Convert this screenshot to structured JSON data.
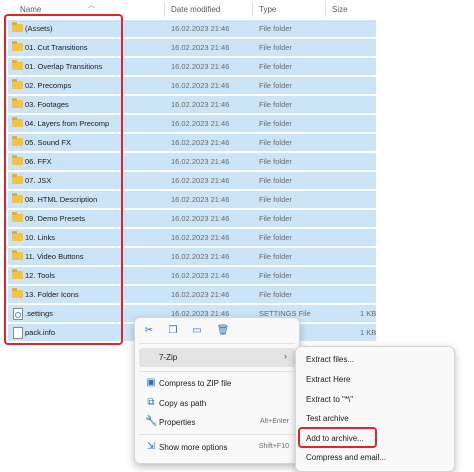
{
  "header": {
    "name": "Name",
    "date": "Date modified",
    "type": "Type",
    "size": "Size"
  },
  "files": [
    {
      "name": "(Assets)",
      "date": "16.02.2023 21:46",
      "type": "File folder",
      "size": "",
      "icon": "folder-icon"
    },
    {
      "name": "01. Cut Transitions",
      "date": "16.02.2023 21:46",
      "type": "File folder",
      "size": "",
      "icon": "folder-icon"
    },
    {
      "name": "01. Overlap Transitions",
      "date": "16.02.2023 21:46",
      "type": "File folder",
      "size": "",
      "icon": "folder-icon"
    },
    {
      "name": "02. Precomps",
      "date": "16.02.2023 21:46",
      "type": "File folder",
      "size": "",
      "icon": "folder-icon"
    },
    {
      "name": "03. Footages",
      "date": "16.02.2023 21:46",
      "type": "File folder",
      "size": "",
      "icon": "folder-icon"
    },
    {
      "name": "04. Layers from Precomp",
      "date": "16.02.2023 21:46",
      "type": "File folder",
      "size": "",
      "icon": "folder-icon"
    },
    {
      "name": "05. Sound FX",
      "date": "16.02.2023 21:46",
      "type": "File folder",
      "size": "",
      "icon": "folder-icon"
    },
    {
      "name": "06. FFX",
      "date": "16.02.2023 21:46",
      "type": "File folder",
      "size": "",
      "icon": "folder-icon"
    },
    {
      "name": "07. JSX",
      "date": "16.02.2023 21:46",
      "type": "File folder",
      "size": "",
      "icon": "folder-icon"
    },
    {
      "name": "08. HTML Description",
      "date": "16.02.2023 21:46",
      "type": "File folder",
      "size": "",
      "icon": "folder-icon"
    },
    {
      "name": "09. Demo Presets",
      "date": "16.02.2023 21:46",
      "type": "File folder",
      "size": "",
      "icon": "folder-icon"
    },
    {
      "name": "10. Links",
      "date": "16.02.2023 21:46",
      "type": "File folder",
      "size": "",
      "icon": "folder-icon"
    },
    {
      "name": "11. Video Buttons",
      "date": "16.02.2023 21:46",
      "type": "File folder",
      "size": "",
      "icon": "folder-icon"
    },
    {
      "name": "12. Tools",
      "date": "16.02.2023 21:46",
      "type": "File folder",
      "size": "",
      "icon": "folder-icon"
    },
    {
      "name": "13. Folder Icons",
      "date": "16.02.2023 21:46",
      "type": "File folder",
      "size": "",
      "icon": "folder-icon"
    },
    {
      "name": ".settings",
      "date": "16.02.2023 21:46",
      "type": "SETTINGS File",
      "size": "1 KB",
      "icon": "settings-file-icon"
    },
    {
      "name": "pack.info",
      "date": "",
      "type": "",
      "size": "1 KB",
      "icon": "file-icon"
    }
  ],
  "context_menu": {
    "toolbar": [
      "cut-icon",
      "copy-icon",
      "rename-icon",
      "delete-icon"
    ],
    "items": [
      {
        "label": "7-Zip",
        "shortcut": "",
        "icon": "",
        "has_submenu": true
      },
      {
        "label": "Compress to ZIP file",
        "shortcut": "",
        "icon": "zip-icon"
      },
      {
        "label": "Copy as path",
        "shortcut": "",
        "icon": "copy-path-icon"
      },
      {
        "label": "Properties",
        "shortcut": "Alt+Enter",
        "icon": "properties-icon"
      },
      {
        "label": "Show more options",
        "shortcut": "Shift+F10",
        "icon": "more-options-icon"
      }
    ]
  },
  "submenu": {
    "items": [
      {
        "label": "Extract files..."
      },
      {
        "label": "Extract Here"
      },
      {
        "label": "Extract to \"*\\\""
      },
      {
        "label": "Test archive"
      },
      {
        "label": "Add to archive..."
      },
      {
        "label": "Compress and email..."
      }
    ]
  },
  "colors": {
    "selection": "#cce4f7",
    "highlight_box": "#e0262b",
    "folder": "#f5c344"
  }
}
